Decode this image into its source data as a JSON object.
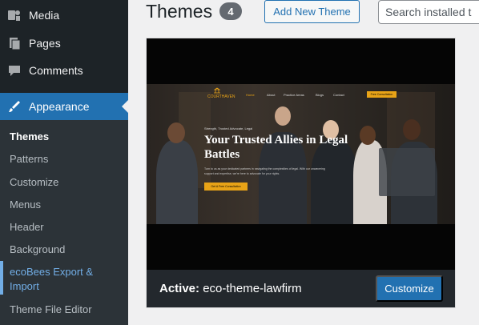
{
  "sidebar": {
    "menu": [
      {
        "label": "Media",
        "icon": "media-icon"
      },
      {
        "label": "Pages",
        "icon": "pages-icon"
      },
      {
        "label": "Comments",
        "icon": "comments-icon"
      },
      {
        "label": "Appearance",
        "icon": "appearance-icon"
      }
    ],
    "submenu": [
      {
        "label": "Themes"
      },
      {
        "label": "Patterns"
      },
      {
        "label": "Customize"
      },
      {
        "label": "Menus"
      },
      {
        "label": "Header"
      },
      {
        "label": "Background"
      },
      {
        "label": "ecoBees Export & Import"
      },
      {
        "label": "Theme File Editor"
      }
    ]
  },
  "header": {
    "title": "Themes",
    "count": "4",
    "add_new_label": "Add New Theme",
    "search_placeholder": "Search installed themes..."
  },
  "theme": {
    "preview": {
      "logo_text": "COURTHAVEN",
      "nav": [
        "Home",
        "About",
        "Practice Areas",
        "Blogs",
        "Contact"
      ],
      "consult_label": "Free Consultation",
      "tagline": "Strength, Trusted Advocate, Legal",
      "title": "Your Trusted Allies in Legal Battles",
      "body": "Turn to us as your dedicated partners in navigating the complexities of legal. With our unwavering support and expertise, we're here to advocate for your rights.",
      "cta_label": "Get A Free Consultation"
    },
    "active_prefix": "Active:",
    "active_name": "eco-theme-lawfirm",
    "customize_label": "Customize"
  },
  "colors": {
    "accent": "#2271b1",
    "sidebar_bg": "#1d2327",
    "gold": "#e8a317"
  }
}
